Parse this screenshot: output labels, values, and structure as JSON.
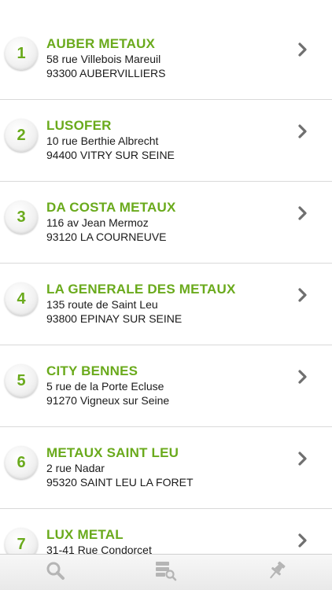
{
  "recyclers": [
    {
      "number": "1",
      "name": "AUBER METAUX",
      "street": "58 rue Villebois Mareuil",
      "city": "93300 AUBERVILLIERS"
    },
    {
      "number": "2",
      "name": "LUSOFER",
      "street": "10 rue Berthie Albrecht",
      "city": "94400 VITRY SUR SEINE"
    },
    {
      "number": "3",
      "name": "DA COSTA METAUX",
      "street": "116 av Jean Mermoz",
      "city": "93120 LA COURNEUVE"
    },
    {
      "number": "4",
      "name": "LA GENERALE DES METAUX",
      "street": "135 route de Saint Leu",
      "city": "93800 EPINAY SUR SEINE"
    },
    {
      "number": "5",
      "name": "CITY BENNES",
      "street": "5 rue de la Porte Ecluse",
      "city": "91270 Vigneux sur Seine"
    },
    {
      "number": "6",
      "name": "METAUX SAINT LEU",
      "street": "2 rue Nadar",
      "city": "95320 SAINT LEU LA FORET"
    },
    {
      "number": "7",
      "name": "LUX METAL",
      "street": "31-41 Rue Condorcet",
      "city": ""
    }
  ],
  "tabbar": {
    "tabs": [
      {
        "icon": "search-icon"
      },
      {
        "icon": "list-search-icon"
      },
      {
        "icon": "pin-icon"
      }
    ]
  },
  "colors": {
    "accent": "#6aaa1c",
    "text": "#1a1a1a",
    "separator": "#d9d9d9",
    "chevron": "#6f6f6f",
    "tab_icon": "#b5b5b5"
  }
}
